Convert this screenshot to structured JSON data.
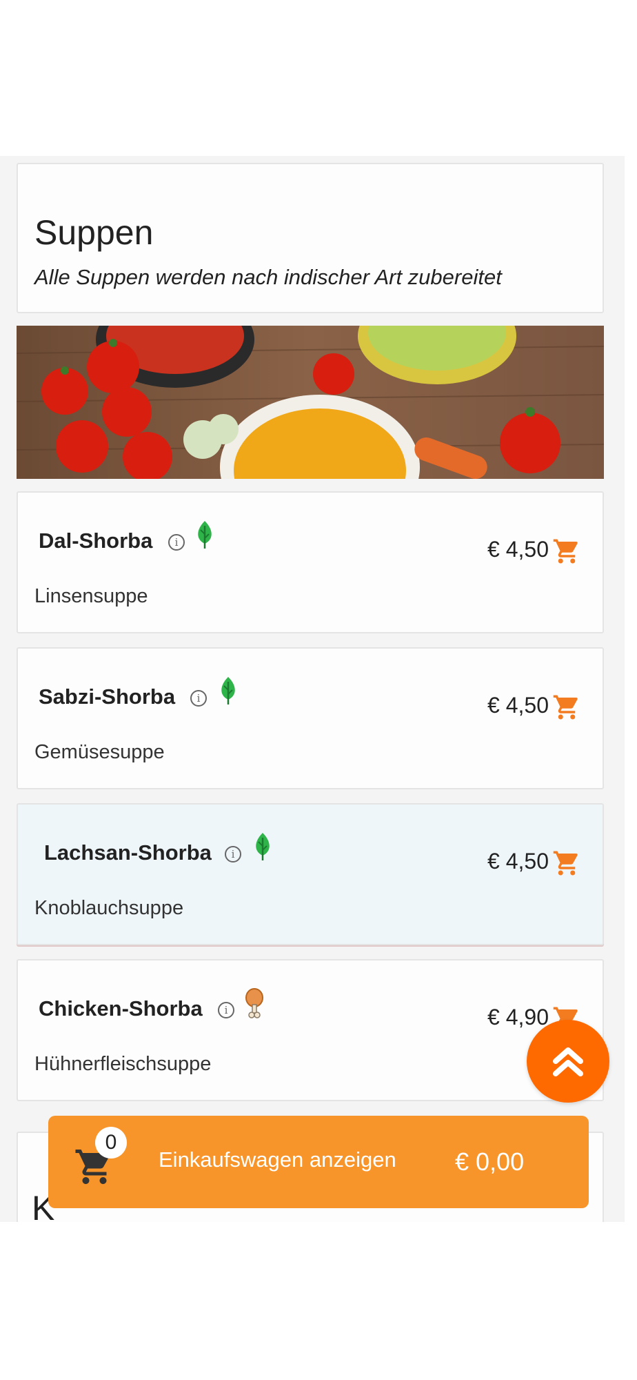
{
  "section": {
    "title": "Suppen",
    "subtitle": "Alle Suppen werden nach indischer Art zubereitet"
  },
  "items": [
    {
      "name": "Dal-Shorba",
      "description": "Linsensuppe",
      "price": "€ 4,50",
      "tag_icon": "leaf-icon"
    },
    {
      "name": "Sabzi-Shorba",
      "description": "Gemüsesuppe",
      "price": "€ 4,50",
      "tag_icon": "leaf-icon"
    },
    {
      "name": "Lachsan-Shorba",
      "description": "Knoblauchsuppe",
      "price": "€ 4,50",
      "tag_icon": "leaf-icon"
    },
    {
      "name": "Chicken-Shorba",
      "description": "Hühnerfleischsuppe",
      "price": "€ 4,90",
      "tag_icon": "drumstick-icon"
    }
  ],
  "cart": {
    "count": "0",
    "label": "Einkaufswagen anzeigen",
    "total": "€ 0,00"
  },
  "next_section_title": "K",
  "colors": {
    "accent": "#f7952a",
    "fab": "#ff6a00",
    "cart_icon": "#f47c20",
    "veg_green": "#2fb44a",
    "highlight_bg": "#eef6fa"
  }
}
